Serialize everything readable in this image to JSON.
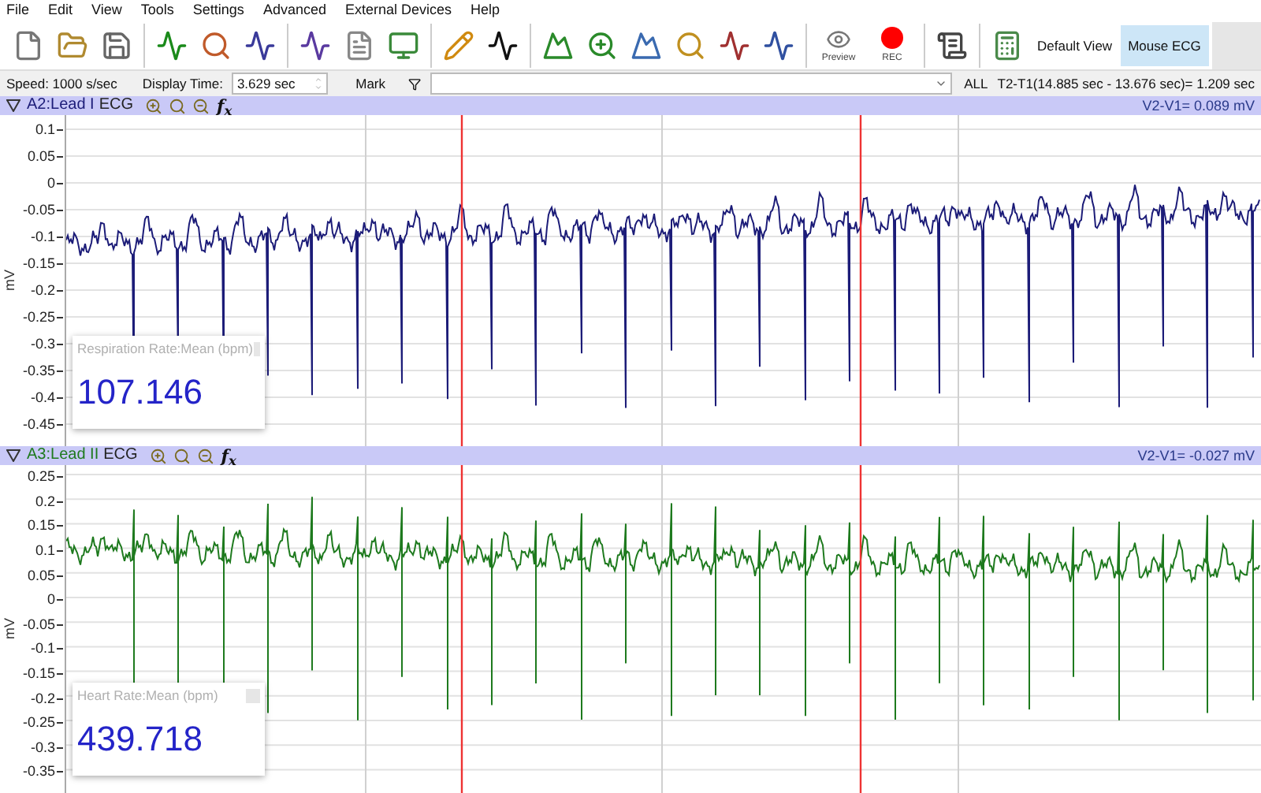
{
  "menu": [
    "File",
    "Edit",
    "View",
    "Tools",
    "Settings",
    "Advanced",
    "External Devices",
    "Help"
  ],
  "toolbar": {
    "preview_label": "Preview",
    "rec_label": "REC",
    "views": [
      {
        "label": "Default View",
        "selected": false
      },
      {
        "label": "Mouse ECG",
        "selected": true
      }
    ]
  },
  "controls": {
    "speed": "Speed: 1000 s/sec",
    "display_time_label": "Display Time:",
    "display_time_value": "3.629 sec",
    "mark_label": "Mark",
    "all_label": "ALL",
    "interval": "T2-T1(14.885 sec - 13.676 sec)= 1.209 sec"
  },
  "panels": [
    {
      "channel": "A2:Lead I",
      "type": "ECG",
      "fx": "f$_{x}$",
      "readout": "V2-V1= 0.089 mV",
      "y_unit": "mV",
      "color": "#1c1c78",
      "y_ticks": [
        "0.1",
        "0.05",
        "0",
        "-0.05",
        "-0.1",
        "-0.15",
        "-0.2",
        "-0.25",
        "-0.3",
        "-0.35",
        "-0.4",
        "-0.45"
      ],
      "measurement": {
        "label": "Respiration Rate:Mean (bpm)",
        "value": "107.146"
      }
    },
    {
      "channel": "A3:Lead II",
      "type": "ECG",
      "fx": "f$_{x}$",
      "readout": "V2-V1= -0.027 mV",
      "y_unit": "mV",
      "color": "#1e7a1e",
      "y_ticks": [
        "0.25",
        "0.2",
        "0.15",
        "0.1",
        "0.05",
        "0",
        "-0.05",
        "-0.1",
        "-0.15",
        "-0.2",
        "-0.25",
        "-0.3",
        "-0.35"
      ],
      "measurement": {
        "label": "Heart Rate:Mean (bpm)",
        "value": "439.718"
      }
    }
  ]
}
